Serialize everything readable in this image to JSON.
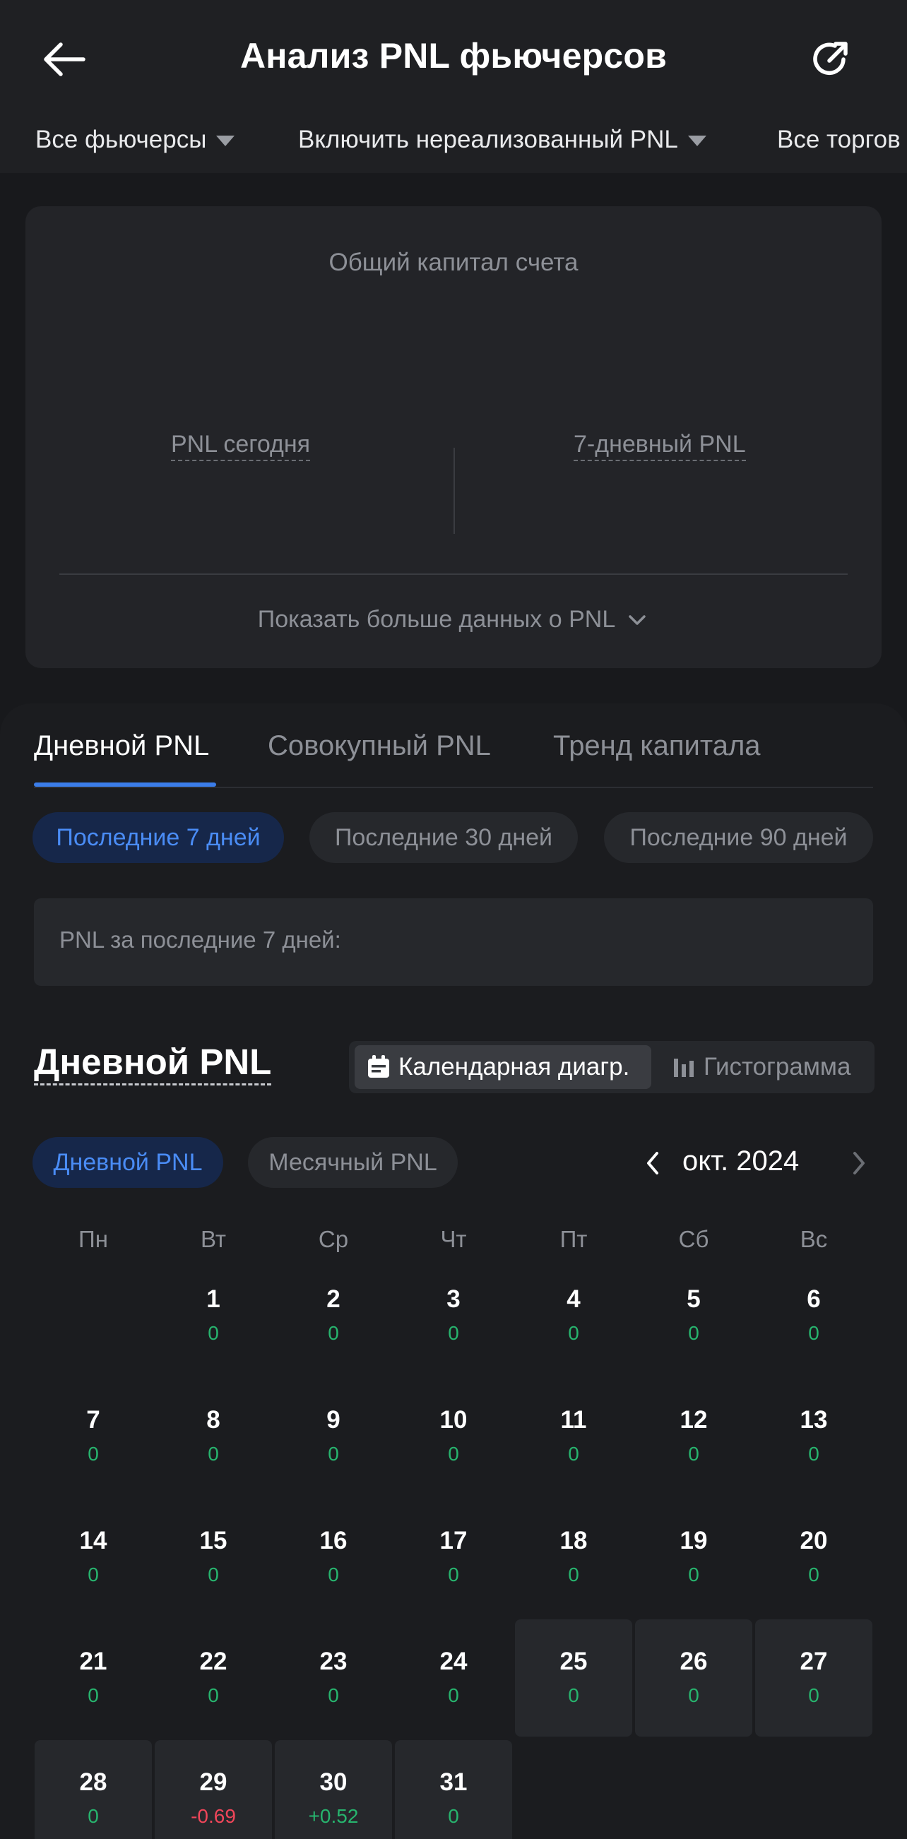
{
  "header": {
    "title": "Анализ PNL фьючерсов",
    "filters": [
      "Все фьючерсы",
      "Включить нереализованный PNL",
      "Все торгов"
    ]
  },
  "summary": {
    "title": "Общий капитал счета",
    "today_pnl_label": "PNL сегодня",
    "week_pnl_label": "7-дневный PNL",
    "more_label": "Показать больше данных о PNL"
  },
  "tabs": [
    "Дневной PNL",
    "Совокупный PNL",
    "Тренд капитала"
  ],
  "periods": [
    "Последние 7 дней",
    "Последние 30 дней",
    "Последние 90 дней"
  ],
  "period_pnl_label": "PNL за последние 7 дней:",
  "section": {
    "title": "Дневной PNL",
    "view_calendar": "Календарная диагр.",
    "view_histogram": "Гистограмма"
  },
  "calendar": {
    "modes": [
      "Дневной PNL",
      "Месячный PNL"
    ],
    "month": "окт. 2024",
    "weekdays": [
      "Пн",
      "Вт",
      "Ср",
      "Чт",
      "Пт",
      "Сб",
      "Вс"
    ],
    "days": [
      {
        "day": "1",
        "value": "0"
      },
      {
        "day": "2",
        "value": "0"
      },
      {
        "day": "3",
        "value": "0"
      },
      {
        "day": "4",
        "value": "0"
      },
      {
        "day": "5",
        "value": "0"
      },
      {
        "day": "6",
        "value": "0"
      },
      {
        "day": "7",
        "value": "0"
      },
      {
        "day": "8",
        "value": "0"
      },
      {
        "day": "9",
        "value": "0"
      },
      {
        "day": "10",
        "value": "0"
      },
      {
        "day": "11",
        "value": "0"
      },
      {
        "day": "12",
        "value": "0"
      },
      {
        "day": "13",
        "value": "0"
      },
      {
        "day": "14",
        "value": "0"
      },
      {
        "day": "15",
        "value": "0"
      },
      {
        "day": "16",
        "value": "0"
      },
      {
        "day": "17",
        "value": "0"
      },
      {
        "day": "18",
        "value": "0"
      },
      {
        "day": "19",
        "value": "0"
      },
      {
        "day": "20",
        "value": "0"
      },
      {
        "day": "21",
        "value": "0"
      },
      {
        "day": "22",
        "value": "0"
      },
      {
        "day": "23",
        "value": "0"
      },
      {
        "day": "24",
        "value": "0"
      },
      {
        "day": "25",
        "value": "0"
      },
      {
        "day": "26",
        "value": "0"
      },
      {
        "day": "27",
        "value": "0"
      },
      {
        "day": "28",
        "value": "0"
      },
      {
        "day": "29",
        "value": "-0.69"
      },
      {
        "day": "30",
        "value": "+0.52"
      },
      {
        "day": "31",
        "value": "0"
      }
    ]
  },
  "colors": {
    "accent": "#3b7de9",
    "positive": "#27b46e",
    "negative": "#f0465a"
  }
}
